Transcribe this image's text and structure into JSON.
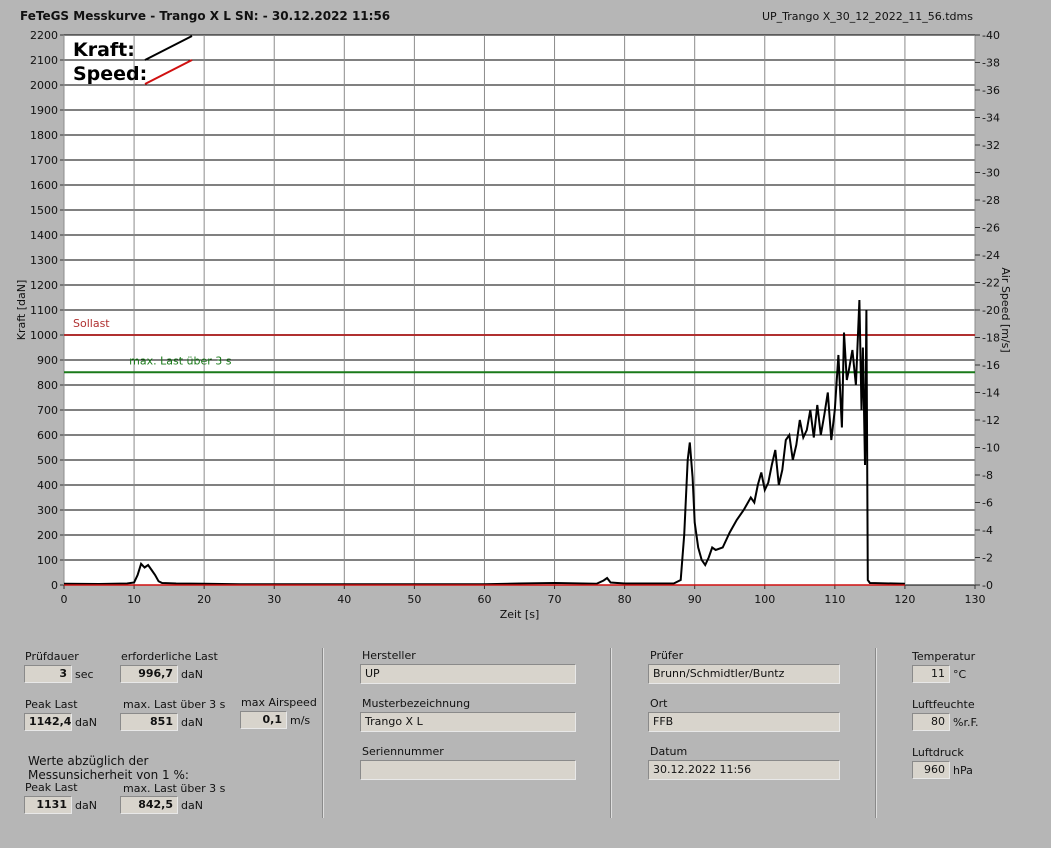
{
  "header": {
    "title": "FeTeGS Messkurve - Trango X L  SN:  - 30.12.2022 11:56",
    "file": "UP_Trango X_30_12_2022_11_56.tdms"
  },
  "chart_data": {
    "type": "line",
    "xlabel": "Zeit [s]",
    "ylabel": "Kraft [daN]",
    "y2label": "Air Speed [m/s]",
    "xlim": [
      0,
      130
    ],
    "ylim": [
      0,
      2200
    ],
    "y2lim": [
      0,
      40
    ],
    "xticks": [
      0,
      10,
      20,
      30,
      40,
      50,
      60,
      70,
      80,
      90,
      100,
      110,
      120,
      130
    ],
    "yticks": [
      0,
      100,
      200,
      300,
      400,
      500,
      600,
      700,
      800,
      900,
      1000,
      1100,
      1200,
      1300,
      1400,
      1500,
      1600,
      1700,
      1800,
      1900,
      2000,
      2100,
      2200
    ],
    "y2ticks": [
      0,
      2,
      4,
      6,
      8,
      10,
      12,
      14,
      16,
      18,
      20,
      22,
      24,
      26,
      28,
      30,
      32,
      34,
      36,
      38,
      40
    ],
    "grid": true,
    "legend": {
      "placement": "top-left",
      "items": [
        {
          "label": "Kraft:",
          "color": "#000000"
        },
        {
          "label": "Speed:",
          "color": "#d01010"
        }
      ]
    },
    "reference_lines": [
      {
        "label": "Sollast",
        "y": 1000,
        "color": "#b03030"
      },
      {
        "label": "max. Last über  3 s",
        "y": 851,
        "color": "#1a7a1a"
      }
    ],
    "series": [
      {
        "name": "Kraft",
        "color": "#000000",
        "points": [
          [
            0,
            5
          ],
          [
            5,
            4
          ],
          [
            9,
            6
          ],
          [
            10,
            10
          ],
          [
            10.5,
            40
          ],
          [
            11,
            85
          ],
          [
            11.5,
            70
          ],
          [
            12,
            80
          ],
          [
            12.5,
            60
          ],
          [
            13,
            40
          ],
          [
            13.5,
            15
          ],
          [
            14,
            8
          ],
          [
            16,
            6
          ],
          [
            20,
            5
          ],
          [
            25,
            3
          ],
          [
            30,
            3
          ],
          [
            40,
            3
          ],
          [
            50,
            3
          ],
          [
            60,
            3
          ],
          [
            65,
            6
          ],
          [
            70,
            8
          ],
          [
            74,
            6
          ],
          [
            76,
            5
          ],
          [
            77,
            18
          ],
          [
            77.5,
            28
          ],
          [
            78,
            10
          ],
          [
            80,
            6
          ],
          [
            84,
            6
          ],
          [
            87,
            6
          ],
          [
            88,
            20
          ],
          [
            88.5,
            200
          ],
          [
            89,
            500
          ],
          [
            89.3,
            570
          ],
          [
            89.7,
            430
          ],
          [
            90,
            250
          ],
          [
            90.5,
            150
          ],
          [
            91,
            100
          ],
          [
            91.5,
            80
          ],
          [
            92,
            110
          ],
          [
            92.5,
            150
          ],
          [
            93,
            140
          ],
          [
            94,
            150
          ],
          [
            95,
            210
          ],
          [
            96,
            260
          ],
          [
            97,
            300
          ],
          [
            98,
            350
          ],
          [
            98.5,
            330
          ],
          [
            99,
            400
          ],
          [
            99.5,
            450
          ],
          [
            100,
            380
          ],
          [
            100.5,
            410
          ],
          [
            101,
            480
          ],
          [
            101.5,
            540
          ],
          [
            102,
            400
          ],
          [
            102.5,
            460
          ],
          [
            103,
            580
          ],
          [
            103.5,
            600
          ],
          [
            104,
            500
          ],
          [
            104.5,
            560
          ],
          [
            105,
            660
          ],
          [
            105.5,
            590
          ],
          [
            106,
            620
          ],
          [
            106.5,
            700
          ],
          [
            107,
            590
          ],
          [
            107.5,
            720
          ],
          [
            108,
            600
          ],
          [
            108.5,
            680
          ],
          [
            109,
            770
          ],
          [
            109.5,
            580
          ],
          [
            110,
            700
          ],
          [
            110.5,
            920
          ],
          [
            111,
            630
          ],
          [
            111.3,
            1010
          ],
          [
            111.7,
            820
          ],
          [
            112,
            860
          ],
          [
            112.5,
            940
          ],
          [
            113,
            800
          ],
          [
            113.5,
            1140
          ],
          [
            113.8,
            700
          ],
          [
            114,
            950
          ],
          [
            114.3,
            480
          ],
          [
            114.5,
            1100
          ],
          [
            114.7,
            20
          ],
          [
            115,
            8
          ],
          [
            120,
            5
          ]
        ]
      },
      {
        "name": "Speed",
        "color": "#d01010",
        "points": [
          [
            0,
            0
          ],
          [
            120,
            0
          ]
        ]
      }
    ]
  },
  "stats": {
    "pruefdauer_label": "Prüfdauer",
    "pruefdauer_value": "3",
    "pruefdauer_unit": "sec",
    "erf_last_label": "erforderliche Last",
    "erf_last_value": "996,7",
    "erf_last_unit": "daN",
    "peak_label": "Peak Last",
    "peak_value": "1142,4",
    "peak_unit": "daN",
    "maxlast_label": "max. Last über  3 s",
    "maxlast_value": "851",
    "maxlast_unit": "daN",
    "airspeed_label": "max Airspeed",
    "airspeed_value": "0,1",
    "airspeed_unit": "m/s",
    "werte_text": "Werte abzüglich der",
    "mess_text": "Messunsicherheit von 1   %:",
    "peak2_label": "Peak Last",
    "peak2_value": "1131",
    "peak2_unit": "daN",
    "maxlast2_label": "max. Last über  3 s",
    "maxlast2_value": "842,5",
    "maxlast2_unit": "daN"
  },
  "info": {
    "hersteller_label": "Hersteller",
    "hersteller_value": "UP",
    "muster_label": "Musterbezeichnung",
    "muster_value": "Trango X L",
    "serien_label": "Seriennummer",
    "serien_value": "",
    "pruefer_label": "Prüfer",
    "pruefer_value": "Brunn/Schmidtler/Buntz",
    "ort_label": "Ort",
    "ort_value": "FFB",
    "datum_label": "Datum",
    "datum_value": "30.12.2022 11:56"
  },
  "env": {
    "temp_label": "Temperatur",
    "temp_value": "11",
    "temp_unit": "°C",
    "feuchte_label": "Luftfeuchte",
    "feuchte_value": "80",
    "feuchte_unit": "%r.F.",
    "druck_label": "Luftdruck",
    "druck_value": "960",
    "druck_unit": "hPa"
  }
}
